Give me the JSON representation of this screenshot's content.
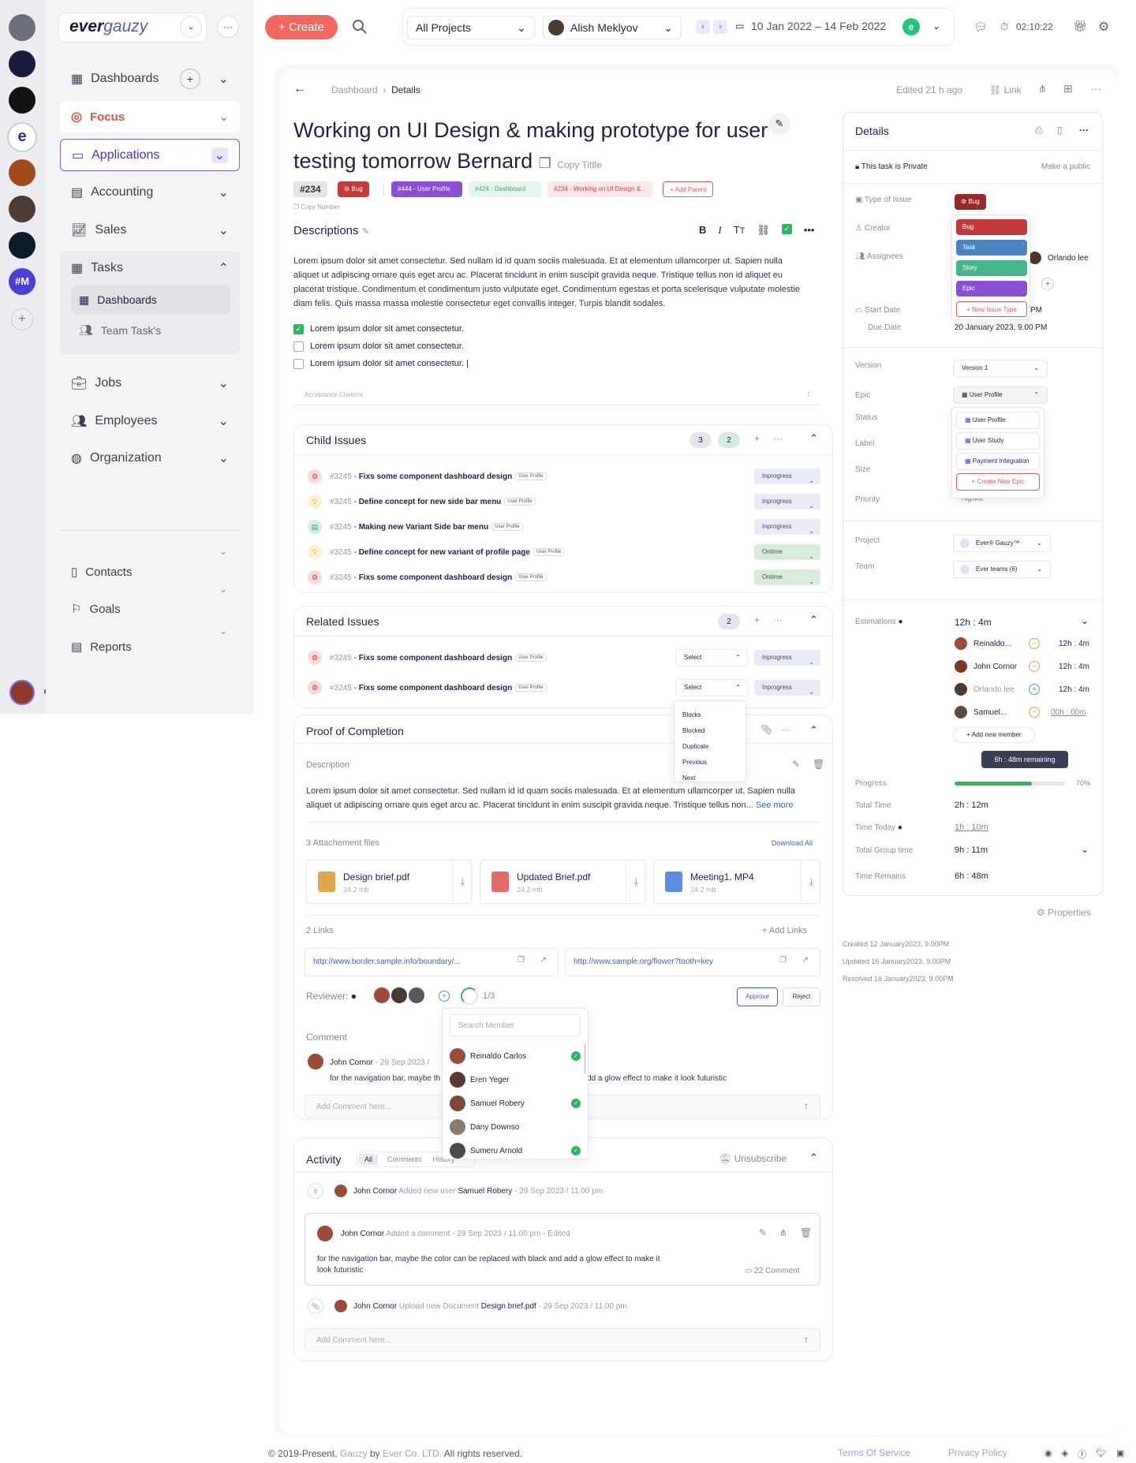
{
  "apps_rail": {
    "items": [
      "app-1",
      "app-2",
      "app-3",
      "ever",
      "app-5",
      "app-6",
      "app-7",
      "#M"
    ]
  },
  "brand": {
    "logo_part1": "ever",
    "logo_part2": "gauzy"
  },
  "sidebar": {
    "items": [
      {
        "label": "Dashboards"
      },
      {
        "label": "Focus"
      },
      {
        "label": "Applications"
      },
      {
        "label": "Accounting"
      },
      {
        "label": "Sales"
      },
      {
        "label": "Tasks"
      },
      {
        "label": "Dashboards"
      },
      {
        "label": "Team Task's"
      },
      {
        "label": "Jobs"
      },
      {
        "label": "Employees"
      },
      {
        "label": "Organization"
      },
      {
        "label": "Contacts"
      },
      {
        "label": "Goals"
      },
      {
        "label": "Reports"
      }
    ]
  },
  "header": {
    "create_label": "Create",
    "project_select": "All Projects",
    "user_name": "Alish Meklyov",
    "date_range": "10 Jan 2022 – 14 Feb 2022",
    "timer": "02:10:22"
  },
  "breadcrumb": {
    "root": "Dashboard",
    "current": "Details",
    "edited": "Edited 21 h ago",
    "link_label": "Link"
  },
  "task": {
    "title_line1": "Working on UI Design & making prototype for user",
    "title_line2": "testing tomorrow Bernard",
    "copy_title": "Copy Tittle",
    "number": "#234",
    "copy_number": "Copy Number",
    "tags": {
      "bug": "Bug",
      "user_profile": "#444 - User Profile",
      "dashboard": "#424 - Dashboard",
      "parent": "#234 - Working on UI Design &...",
      "add_parent": "Add Parent"
    }
  },
  "descriptions": {
    "title": "Descriptions",
    "text": "Lorem ipsum dolor sit amet consectetur. Sed nullam id id quam sociis malesuada. Et at elementum ullamcorper ut. Sapien nulla aliquet ut adipiscing ornare quis eget arcu ac. Placerat tincidunt in enim suscipit gravida neque. Tristique tellus non id aliquet eu placerat tristique. Condimentum et condimentum justo vulputate eget. Condimentum egestas et porta scelerisque vulputate molestie diam felis. Quis massa massa molestie consectetur eget convallis integer. Turpis blandit sodales.",
    "checklist": [
      "Lorem ipsum dolor sit amet consectetur.",
      "Lorem ipsum dolor sit amet consectetur.",
      "Lorem ipsum dolor sit amet consectetur."
    ],
    "acceptance": "Acceptance Crieteria"
  },
  "child_issues": {
    "title": "Child Issues",
    "count1": "3",
    "count2": "2",
    "rows": [
      {
        "id": "#3245",
        "name": "Fixs some component dashboard design",
        "pill": "User Profile",
        "status": "Inprogress"
      },
      {
        "id": "#3245",
        "name": "Define concept for new side bar menu",
        "pill": "User Profile",
        "status": "Inprogress"
      },
      {
        "id": "#3245",
        "name": "Making new Variant Side bar menu",
        "pill": "User Profile",
        "status": "Inprogress"
      },
      {
        "id": "#3245",
        "name": "Define concept for new variant of profile page",
        "pill": "User Profile",
        "status": "Ontime"
      },
      {
        "id": "#3245",
        "name": "Fixs some component dashboard design",
        "pill": "User Profile",
        "status": "Ontime"
      }
    ]
  },
  "related_issues": {
    "title": "Related Issues",
    "count": "2",
    "rows": [
      {
        "id": "#3245",
        "name": "Fixs some component dashboard design",
        "pill": "User Profile",
        "select": "Select",
        "status": "Inprogress"
      },
      {
        "id": "#3245",
        "name": "Fixs some component dashboard design",
        "pill": "User Profile",
        "select": "Select",
        "status": "Inprogress"
      }
    ],
    "relation_options": [
      "Blocks",
      "Blocked",
      "Duplicate",
      "Previous",
      "Next"
    ]
  },
  "proof": {
    "title": "Proof of Completion",
    "desc_label": "Description",
    "text": "Lorem ipsum dolor sit amet consectetur. Sed nullam id id quam sociis malesuada. Et at elementum ullamcorper ut. Sapien nulla aliquet ut adipiscing ornare quis eget arcu ac. Placerat tincidunt in enim suscipit gravida neque. Tristique tellus non...",
    "see_more": "See more",
    "attachments_label": "3 Attachement files",
    "download_all": "Download All",
    "files": [
      {
        "name": "Design brief.pdf",
        "size": "24.2 mb"
      },
      {
        "name": "Updated Brief.pdf",
        "size": "24.2 mb"
      },
      {
        "name": "Meeting1. MP4",
        "size": "24.2 mb"
      }
    ],
    "links_label": "2 Links",
    "add_links": "Add Links",
    "links": [
      "http://www.border.sample.info/boundary/...",
      "http://www.sample.org/flower?tooth=key"
    ],
    "reviewer_label": "Reviewer:",
    "review_count": "1/3",
    "approve": "Approve",
    "reject": "Reject",
    "comment_label": "Comment",
    "comment_author": "John Cornor",
    "comment_date": "29 Sep 2023 /",
    "comment_text_left": "for the navigation bar, maybe th",
    "comment_text_right": "dd a glow effect to make it look futuristic",
    "comment_placeholder": "Add Comment here..."
  },
  "member_search": {
    "placeholder": "Search Member",
    "members": [
      {
        "name": "Reinaldo Carlos",
        "checked": true
      },
      {
        "name": "Eren Yeger",
        "checked": false
      },
      {
        "name": "Samuel Robery",
        "checked": true
      },
      {
        "name": "Dany Downso",
        "checked": false
      },
      {
        "name": "Sumeru Arnold",
        "checked": true
      }
    ]
  },
  "activity": {
    "title": "Activity",
    "tabs": [
      "All",
      "Comments",
      "History"
    ],
    "unsubscribe": "Unsubscribe",
    "entry1": {
      "author": "John Cornor",
      "action": "Added new user",
      "target": "Samuel Robery",
      "date": "29 Sep 2023 / 11.00 pm"
    },
    "entry2": {
      "author": "John Cornor",
      "action": "Added a comment",
      "date": "29 Sep 2023 / 11.00 pm",
      "edited": "Edited",
      "text": "for the navigation bar, maybe the color can be replaced with black and add a glow effect to make it look futuristic",
      "comments": "22 Comment"
    },
    "entry3": {
      "author": "John Cornor",
      "action": "Upload new Document",
      "target": "Design brief.pdf",
      "date": "29 Sep 2023 / 11.00 pm"
    },
    "placeholder": "Add Comment here..."
  },
  "details": {
    "title": "Details",
    "private": "This task is Private",
    "make_public": "Make a public",
    "type_label": "Type of Issue",
    "type_value": "Bug",
    "type_options": [
      "Bug",
      "Task",
      "Story",
      "Epic"
    ],
    "new_issue_type": "New Issue Type",
    "creator_label": "Creator",
    "assignees_label": "Assignees",
    "assignee_name": "Orlando lee",
    "start_label": "Start Date",
    "start_value_suffix": "PM",
    "due_label": "Due Date",
    "due_value": "20 January 2023, 9.00 PM",
    "version_label": "Version",
    "version_value": "Version 1",
    "epic_label": "Epic",
    "epic_value": "User Profile",
    "epic_options": [
      "User Profile",
      "User Study",
      "Payment Integration"
    ],
    "create_epic": "Create New Epic",
    "status_label": "Status",
    "label_label": "Label",
    "size_label": "Size",
    "priority_label": "Priority",
    "priority_value": "Highest",
    "project_label": "Project",
    "project_value": "Ever® Gauzy™",
    "team_label": "Team",
    "team_value": "Ever teams (6)",
    "estimations_label": "Estimations",
    "estimation_total": "12h : 4m",
    "estimations": [
      {
        "name": "Reinaldo...",
        "value": "12h : 4m"
      },
      {
        "name": "John Cornor",
        "value": "12h : 4m"
      },
      {
        "name": "Orlando lee",
        "value": "12h : 4m"
      },
      {
        "name": "Samuel...",
        "value": "00h : 00m"
      }
    ],
    "add_member": "Add new member",
    "tooltip": "6h : 48m remaining",
    "progress_label": "Progress",
    "progress_value": "70%",
    "progress_fraction": 0.7,
    "total_time_label": "Total Time",
    "total_time": "2h : 12m",
    "time_today_label": "Time Today",
    "time_today": "1h : 10m",
    "group_time_label": "Total Group time",
    "group_time": "9h : 11m",
    "remains_label": "Time Remains",
    "remains": "6h : 48m",
    "properties": "Properties",
    "created": "Created 12 January2023, 9.00PM",
    "updated": "Updated 16 January2023, 9.00PM",
    "resolved": "Resolved 16 January2023, 9.00PM"
  },
  "footer": {
    "copyright_pre": "© 2019-Present,",
    "gauzy": "Gauzy",
    "by": "by",
    "company": "Ever Co. LTD.",
    "rights": "All rights reserved.",
    "terms": "Terms Of Service",
    "privacy": "Privacy Policy"
  },
  "colors": {
    "accent": "#6a3cd6",
    "create": "#f2685f",
    "bug": "#c43a3a",
    "task": "#4a84c2",
    "story": "#45b58a",
    "epic": "#8a4fd4",
    "green": "#2fb55e"
  }
}
